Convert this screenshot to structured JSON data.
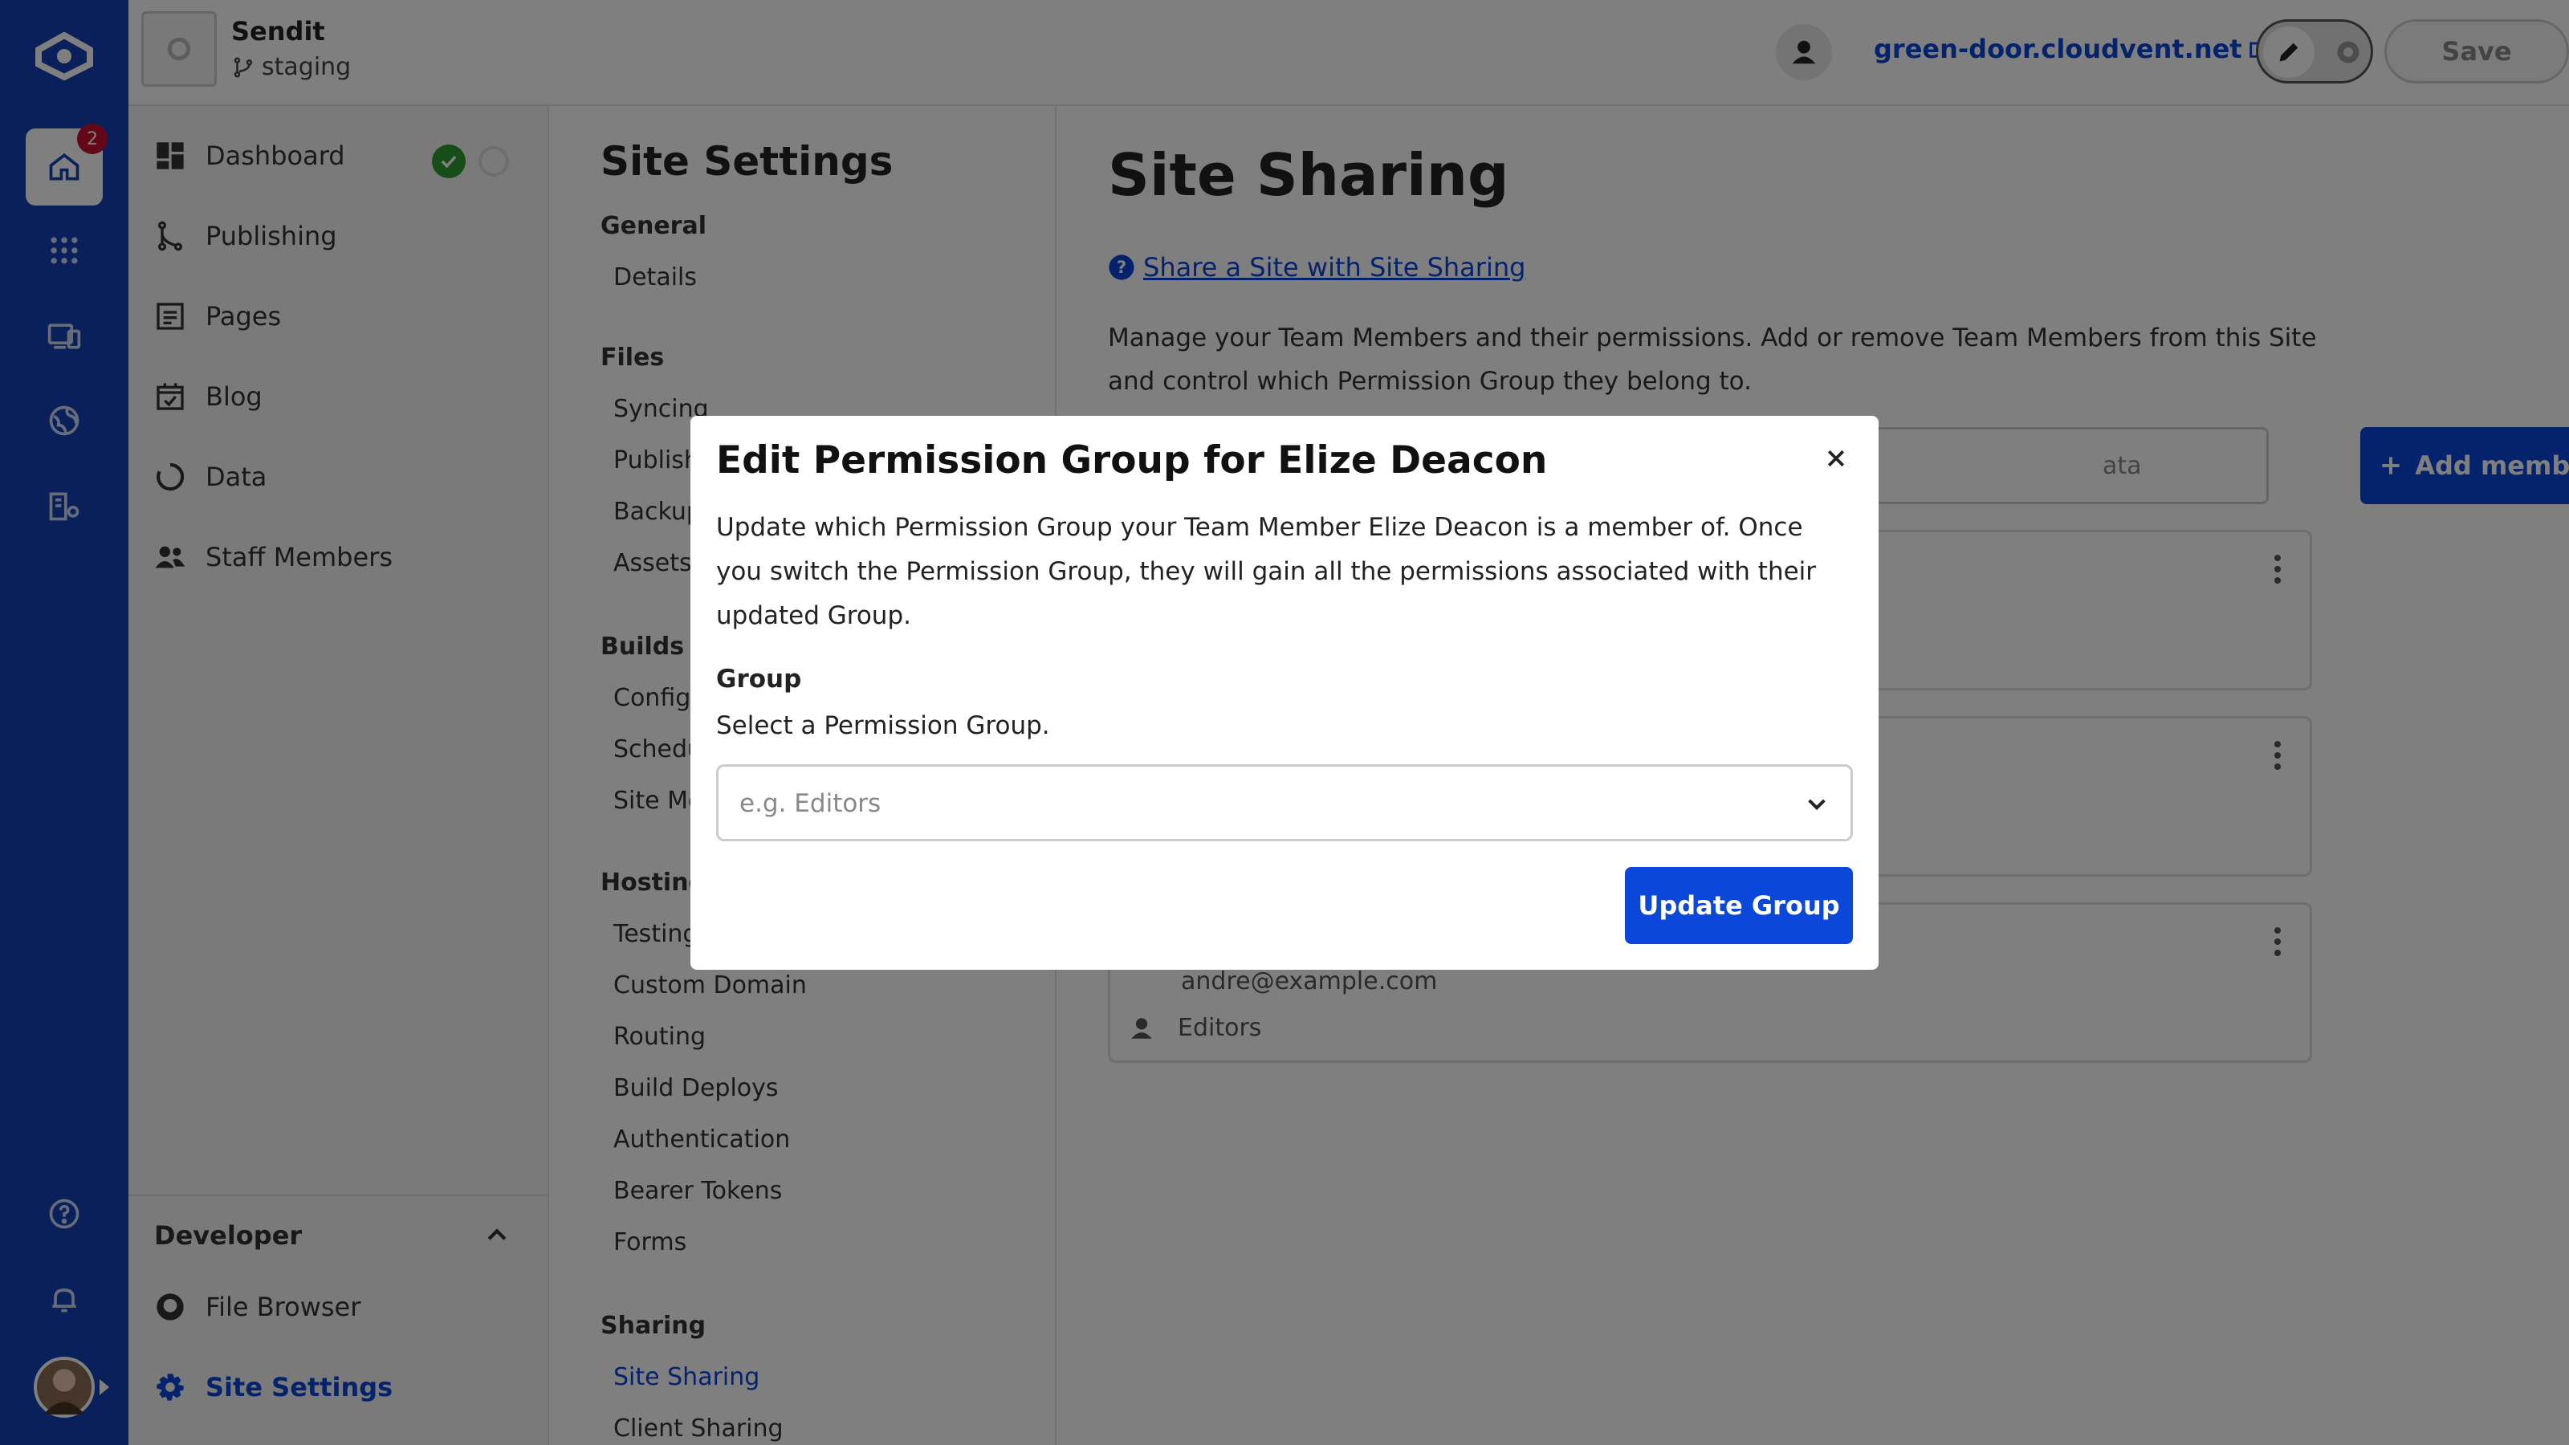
{
  "app": {
    "project_name": "Sendit",
    "branch": "staging",
    "domain_link": "green-door.cloudvent.net",
    "save_label": "Save",
    "notification_count": "2"
  },
  "nav": {
    "items": [
      {
        "label": "Dashboard"
      },
      {
        "label": "Publishing"
      },
      {
        "label": "Pages"
      },
      {
        "label": "Blog"
      },
      {
        "label": "Data"
      },
      {
        "label": "Staff Members"
      }
    ],
    "developer": {
      "heading": "Developer",
      "items": [
        {
          "label": "File Browser"
        },
        {
          "label": "Site Settings"
        }
      ]
    }
  },
  "settings": {
    "title": "Site Settings",
    "sections": [
      {
        "heading": "General",
        "items": [
          "Details"
        ]
      },
      {
        "heading": "Files",
        "items": [
          "Syncing",
          "Publish",
          "Backup",
          "Assets"
        ]
      },
      {
        "heading": "Builds",
        "items": [
          "Config",
          "Schedu",
          "Site Mo"
        ]
      },
      {
        "heading": "Hosting",
        "items": [
          "Testing",
          "Custom Domain",
          "Routing",
          "Build Deploys",
          "Authentication",
          "Bearer Tokens",
          "Forms"
        ]
      },
      {
        "heading": "Sharing",
        "items": [
          "Site Sharing",
          "Client Sharing"
        ]
      }
    ]
  },
  "main": {
    "title": "Site Sharing",
    "help_link": "Share a Site with Site Sharing",
    "description": "Manage your Team Members and their permissions. Add or remove Team Members from this Site and control which Permission Group they belong to.",
    "search_partial": "ata",
    "add_members_label": "Add members",
    "member_email": "andre@example.com",
    "member_group": "Editors"
  },
  "modal": {
    "title": "Edit Permission Group for Elize Deacon",
    "body": "Update which Permission Group your Team Member Elize Deacon is a member of. Once you switch the Permission Group, they will gain all the permissions associated with their updated Group.",
    "field_label": "Group",
    "field_help": "Select a Permission Group.",
    "select_placeholder": "e.g. Editors",
    "submit_label": "Update Group"
  },
  "colors": {
    "rail": "#1441b5",
    "accent": "#0b47d9",
    "success": "#2e9b2e",
    "badge": "#c8102e"
  }
}
